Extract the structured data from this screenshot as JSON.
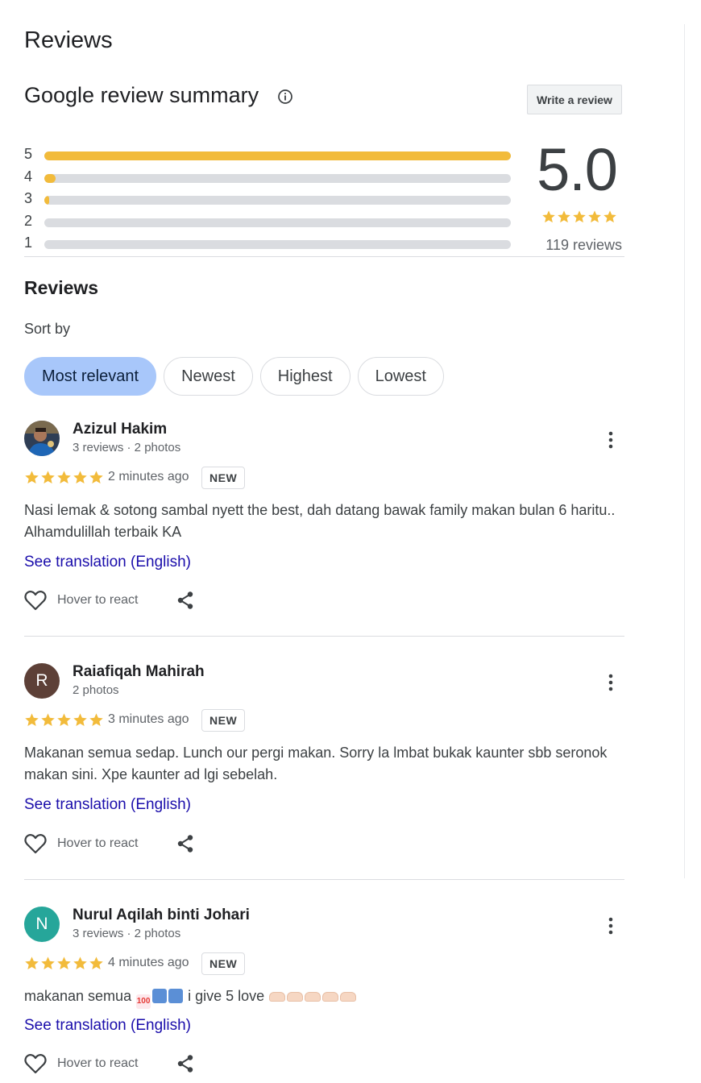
{
  "page": {
    "title": "Reviews"
  },
  "summary": {
    "title": "Google review summary",
    "info_icon": "info-icon",
    "write_review_label": "Write a review",
    "histogram": [
      {
        "stars": "5",
        "fraction": 1.0
      },
      {
        "stars": "4",
        "fraction": 0.025
      },
      {
        "stars": "3",
        "fraction": 0.01
      },
      {
        "stars": "2",
        "fraction": 0.0
      },
      {
        "stars": "1",
        "fraction": 0.0
      }
    ],
    "average": "5.0",
    "star_rating": 5,
    "total": "119 reviews",
    "star_color": "#f2bb3b"
  },
  "reviews_section": {
    "heading": "Reviews",
    "sort_label": "Sort by",
    "sort_options": [
      "Most relevant",
      "Newest",
      "Highest",
      "Lowest"
    ],
    "selected_sort": "Most relevant",
    "active_chip_color": "#a8c7fa"
  },
  "reviews": [
    {
      "name": "Azizul Hakim",
      "meta": "3 reviews · 2 photos",
      "avatar_type": "photo",
      "rating": 5,
      "time": "2 minutes ago",
      "badge": "NEW",
      "text": "Nasi lemak & sotong sambal nyett the best, dah datang bawak family makan bulan 6 haritu.. Alhamdulillah terbaik KA",
      "translation": "See translation (English)",
      "react": "Hover to react"
    },
    {
      "name": "Raiafiqah Mahirah",
      "meta": "2 photos",
      "avatar_letter": "R",
      "avatar_color": "#5d4037",
      "rating": 5,
      "time": "3 minutes ago",
      "badge": "NEW",
      "text": "Makanan semua sedap. Lunch our pergi makan. Sorry la lmbat bukak kaunter sbb seronok makan sini. Xpe kaunter ad lgi sebelah.",
      "translation": "See translation (English)",
      "react": "Hover to react"
    },
    {
      "name": "Nurul Aqilah binti Johari",
      "meta": "3 reviews · 2 photos",
      "avatar_letter": "N",
      "avatar_color": "#26a69a",
      "rating": 5,
      "time": "4 minutes ago",
      "badge": "NEW",
      "text_before": "makanan semua",
      "text_after": "i give 5 love",
      "emojis": [
        "hundred-points-emoji",
        "on-arrow-emoji",
        "top-arrow-emoji"
      ],
      "hand_emojis": [
        "heart-hands-emoji",
        "heart-hands-emoji",
        "heart-hands-emoji",
        "heart-hands-emoji",
        "heart-hands-emoji"
      ],
      "translation": "See translation (English)",
      "react": "Hover to react"
    }
  ]
}
